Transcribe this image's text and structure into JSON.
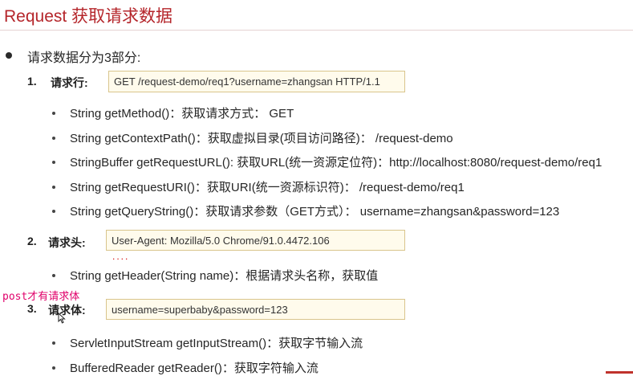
{
  "slide": {
    "title": "Request 获取请求数据",
    "intro": "请求数据分为3部分:",
    "sections": [
      {
        "number": "1.",
        "label": "请求行:",
        "box": "GET /request-demo/req1?username=zhangsan HTTP/1.1",
        "items": [
          "String getMethod()：获取请求方式： GET",
          "String getContextPath()：获取虚拟目录(项目访问路径)： /request-demo",
          "StringBuffer getRequestURL(): 获取URL(统一资源定位符)：http://localhost:8080/request-demo/req1",
          "String getRequestURI()：获取URI(统一资源标识符)： /request-demo/req1",
          "String getQueryString()：获取请求参数（GET方式）： username=zhangsan&password=123"
        ]
      },
      {
        "number": "2.",
        "label": "请求头:",
        "box": "User-Agent: Mozilla/5.0 Chrome/91.0.4472.106",
        "dots": "....",
        "items": [
          "String getHeader(String name)：根据请求头名称，获取值"
        ]
      },
      {
        "number": "3.",
        "label": "请求体:",
        "box": "username=superbaby&password=123",
        "note": "post才有请求体",
        "items": [
          "ServletInputStream  getInputStream()：获取字节输入流",
          "BufferedReader getReader()：获取字符输入流"
        ]
      }
    ]
  }
}
